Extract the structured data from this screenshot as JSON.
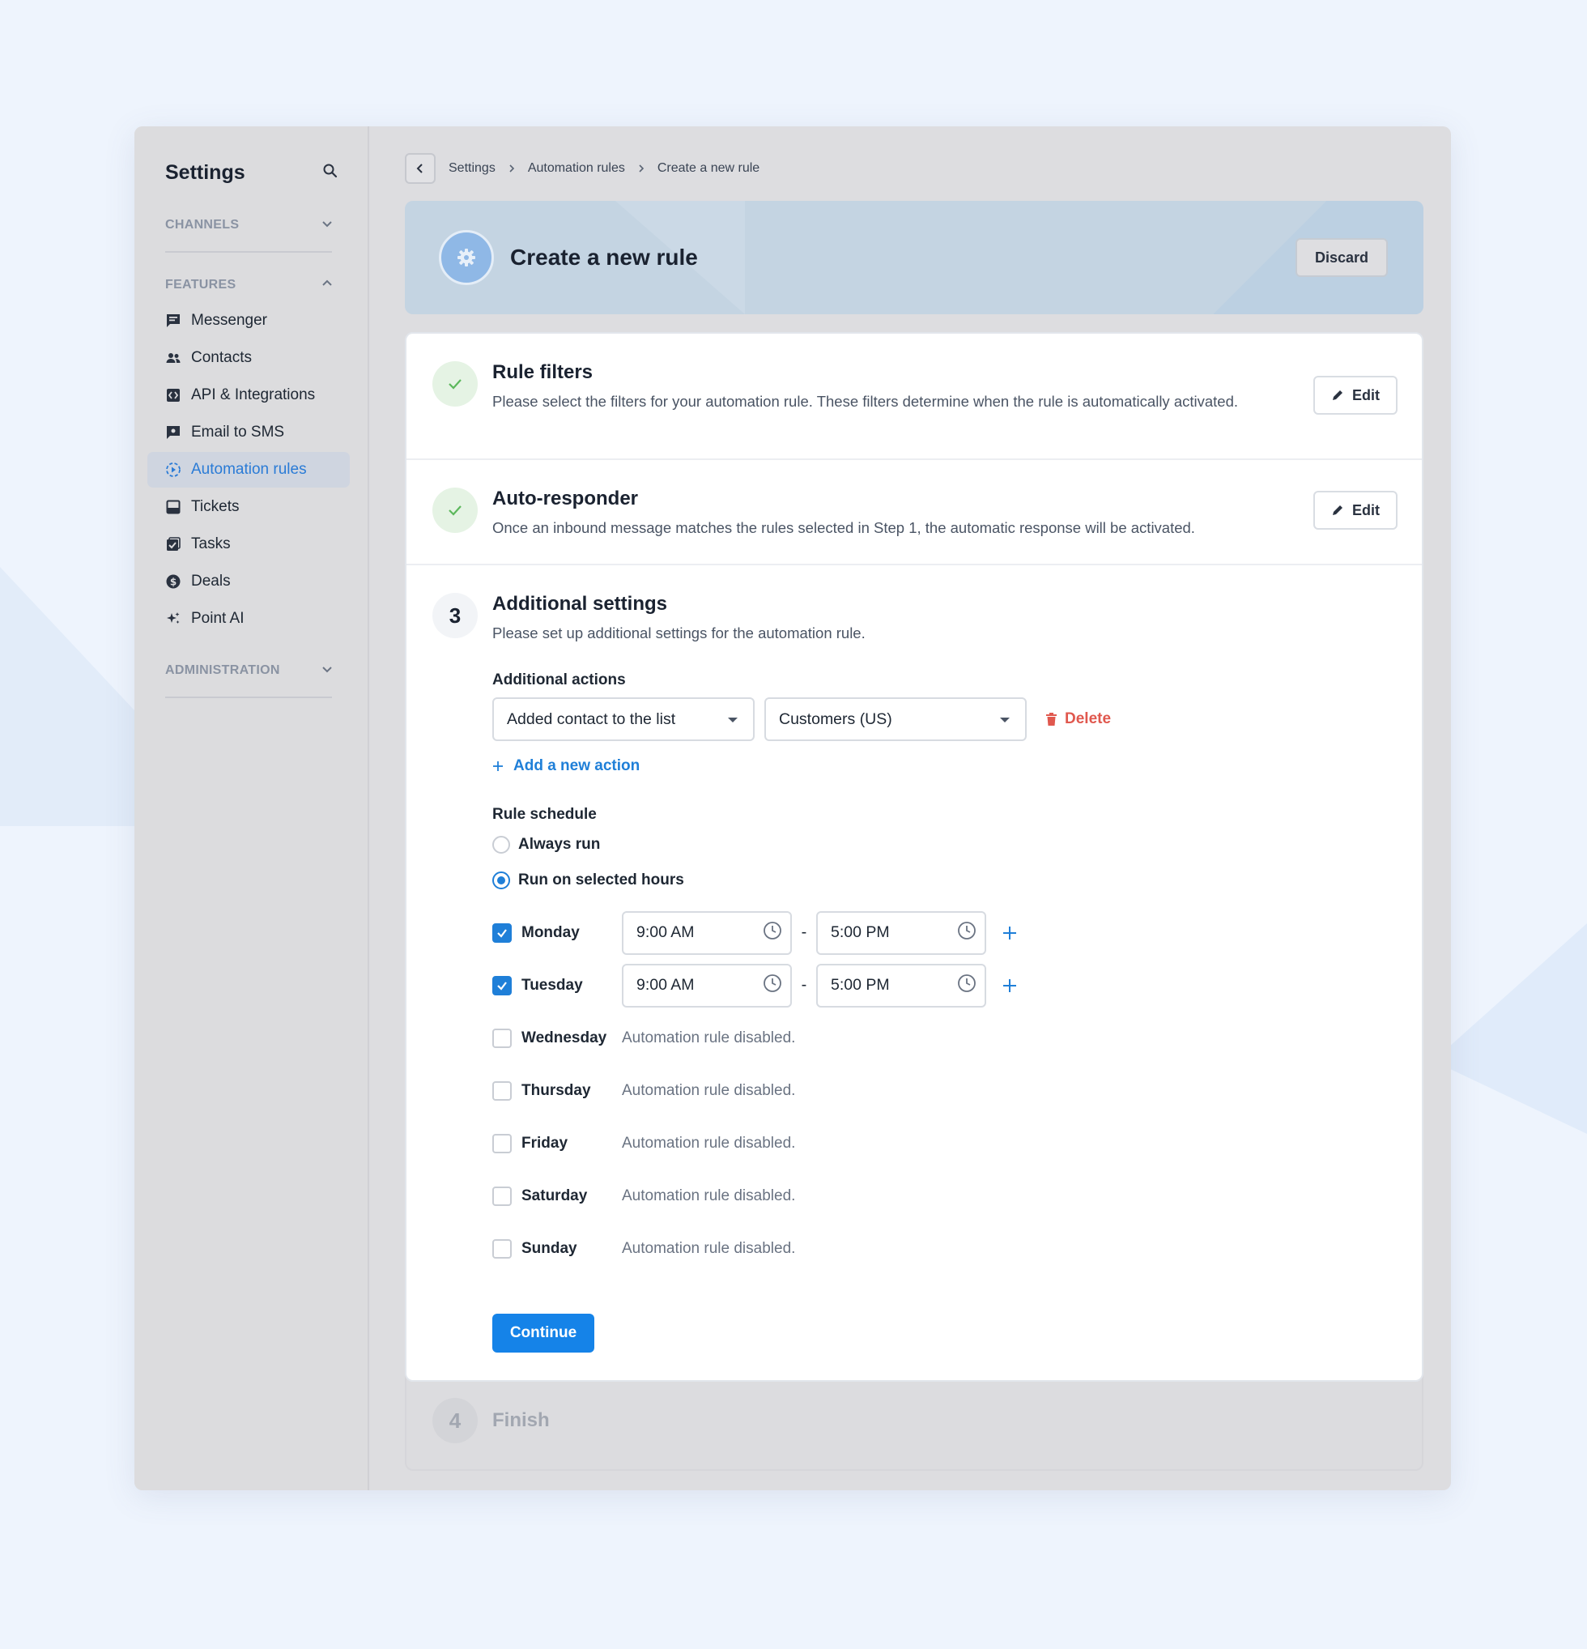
{
  "sidebar": {
    "title": "Settings",
    "sections": {
      "channels": "CHANNELS",
      "features": "FEATURES",
      "administration": "ADMINISTRATION"
    },
    "items": [
      {
        "label": "Messenger",
        "icon": "chat-icon"
      },
      {
        "label": "Contacts",
        "icon": "people-icon"
      },
      {
        "label": "API & Integrations",
        "icon": "code-icon"
      },
      {
        "label": "Email to SMS",
        "icon": "message-icon"
      },
      {
        "label": "Automation rules",
        "icon": "automation-icon",
        "active": true
      },
      {
        "label": "Tickets",
        "icon": "inbox-icon"
      },
      {
        "label": "Tasks",
        "icon": "task-icon"
      },
      {
        "label": "Deals",
        "icon": "dollar-icon"
      },
      {
        "label": "Point AI",
        "icon": "sparkle-icon"
      }
    ]
  },
  "breadcrumb": [
    "Settings",
    "Automation rules",
    "Create a new rule"
  ],
  "header": {
    "title": "Create a new rule",
    "discard_label": "Discard"
  },
  "steps": {
    "filters": {
      "title": "Rule filters",
      "description": "Please select the filters for your automation rule. These filters determine when the rule is automatically activated.",
      "edit_label": "Edit"
    },
    "autoresponder": {
      "title": "Auto-responder",
      "description": "Once an inbound message matches the rules selected in Step 1, the automatic response will be activated.",
      "edit_label": "Edit"
    },
    "additional": {
      "number": "3",
      "title": "Additional settings",
      "description": "Please set up additional settings for the automation rule.",
      "actions_label": "Additional actions",
      "action_select": "Added contact to the list",
      "list_select": "Customers (US)",
      "delete_label": "Delete",
      "add_action_label": "Add a new action",
      "schedule_label": "Rule schedule",
      "always_run": "Always run",
      "selected_hours": "Run on selected hours",
      "days": [
        {
          "name": "Monday",
          "checked": true,
          "start": "9:00 AM",
          "end": "5:00 PM"
        },
        {
          "name": "Tuesday",
          "checked": true,
          "start": "9:00 AM",
          "end": "5:00 PM"
        },
        {
          "name": "Wednesday",
          "checked": false,
          "status": "Automation rule disabled."
        },
        {
          "name": "Thursday",
          "checked": false,
          "status": "Automation rule disabled."
        },
        {
          "name": "Friday",
          "checked": false,
          "status": "Automation rule disabled."
        },
        {
          "name": "Saturday",
          "checked": false,
          "status": "Automation rule disabled."
        },
        {
          "name": "Sunday",
          "checked": false,
          "status": "Automation rule disabled."
        }
      ],
      "continue_label": "Continue"
    },
    "finish": {
      "number": "4",
      "title": "Finish"
    }
  },
  "colors": {
    "accent": "#1583e8",
    "danger": "#e0584e",
    "success": "#5cb85c"
  }
}
